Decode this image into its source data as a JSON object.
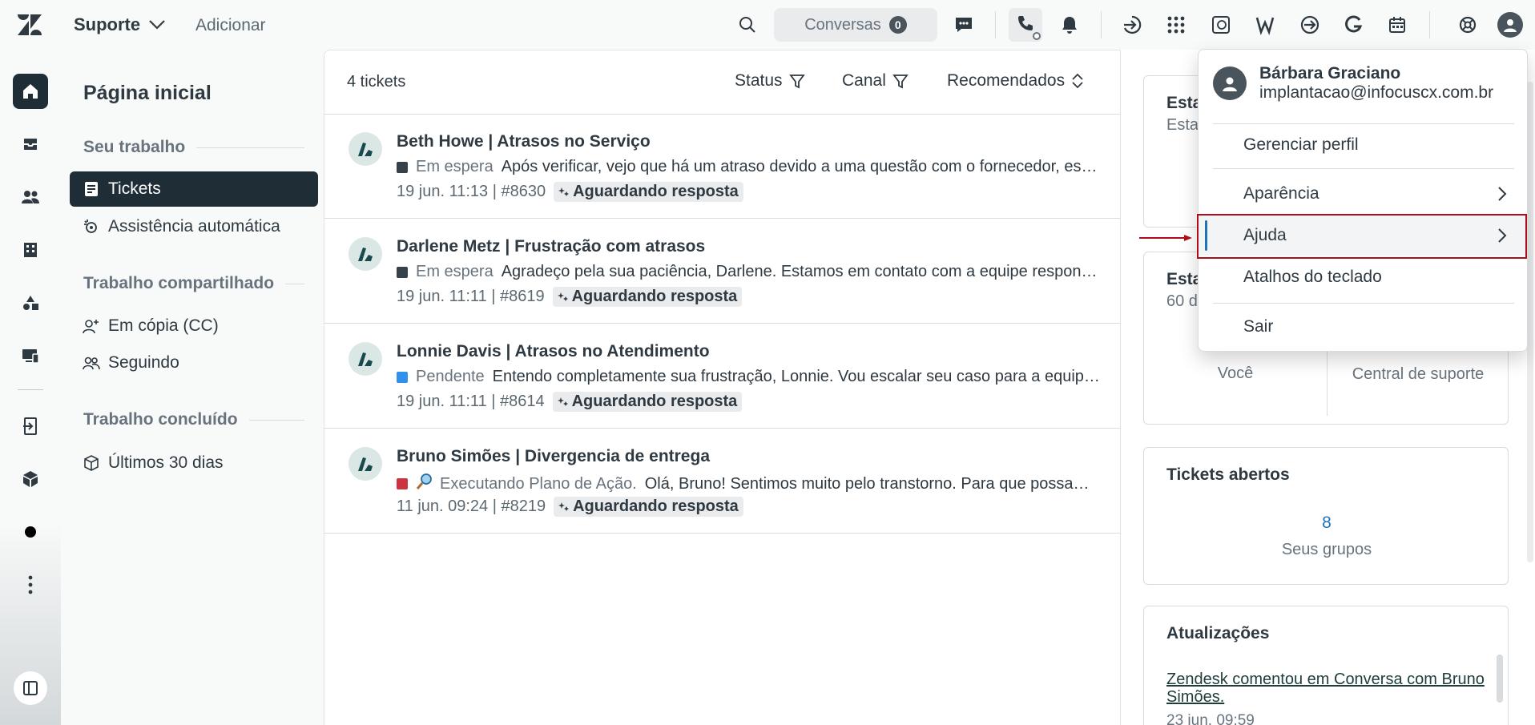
{
  "topbar": {
    "product_label": "Suporte",
    "add_label": "Adicionar",
    "conversations_label": "Conversas",
    "conversations_count": "0"
  },
  "nav": {
    "title": "Página inicial",
    "section_your_work": "Seu trabalho",
    "item_tickets": "Tickets",
    "item_auto_assist": "Assistência automática",
    "section_shared": "Trabalho compartilhado",
    "item_cc": "Em cópia (CC)",
    "item_following": "Seguindo",
    "section_done": "Trabalho concluído",
    "item_last30": "Últimos 30 dias"
  },
  "list": {
    "count": "4 tickets",
    "filter_status": "Status",
    "filter_channel": "Canal",
    "sort_label": "Recomendados",
    "tickets": [
      {
        "title": "Beth Howe | Atrasos no Serviço",
        "status": "Em espera",
        "status_color": "#36414a",
        "preview": "Após verificar, vejo que há um atraso devido a uma questão com o fornecedor, estamos trabalhando para resolver o mais rápido possível.",
        "meta": "19 jun. 11:13 | #8630",
        "badge": "Aguardando resposta"
      },
      {
        "title": "Darlene Metz | Frustração com atrasos",
        "status": "Em espera",
        "status_color": "#36414a",
        "preview": "Agradeço pela sua paciência, Darlene. Estamos em contato com a equipe responsável para agilizar o processo.",
        "meta": "19 jun. 11:11 | #8619",
        "badge": "Aguardando resposta"
      },
      {
        "title": "Lonnie Davis | Atrasos no Atendimento",
        "status": "Pendente",
        "status_color": "#3091ec",
        "preview": "Entendo completamente sua frustração, Lonnie. Vou escalar seu caso para a equipe responsável.",
        "meta": "19 jun. 11:11 | #8614",
        "badge": "Aguardando resposta"
      },
      {
        "title": "Bruno Simões | Divergencia de entrega",
        "status": "Executando Plano de Ação.",
        "status_color": "#cc3340",
        "preview": "Olá, Bruno! Sentimos muito pelo transtorno. Para que possamos resolver a divergência, precisamos de mais detalhes.",
        "meta": "11 jun. 09:24 | #8219",
        "badge": "Aguardando resposta"
      }
    ]
  },
  "right": {
    "card1_title": "Esta",
    "card1_sub": "Esta",
    "card2_title": "Esta",
    "card2_sub": "60 d",
    "you_label": "Você",
    "support_center_label": "Central de suporte",
    "open_tickets_title": "Tickets abertos",
    "open_tickets_value": "8",
    "open_tickets_label": "Seus grupos",
    "updates_title": "Atualizações",
    "update_link": "Zendesk comentou em Conversa com Bruno Simões.",
    "update_time": "23 jun. 09:59"
  },
  "menu": {
    "user_name": "Bárbara Graciano",
    "user_email": "implantacao@infocuscx.com.br",
    "manage_profile": "Gerenciar perfil",
    "appearance": "Aparência",
    "help": "Ajuda",
    "shortcuts": "Atalhos do teclado",
    "logout": "Sair"
  },
  "colors": {
    "accent": "#1f73b7",
    "dark_nav": "#1f2d36",
    "highlight": "#b00d1b"
  }
}
